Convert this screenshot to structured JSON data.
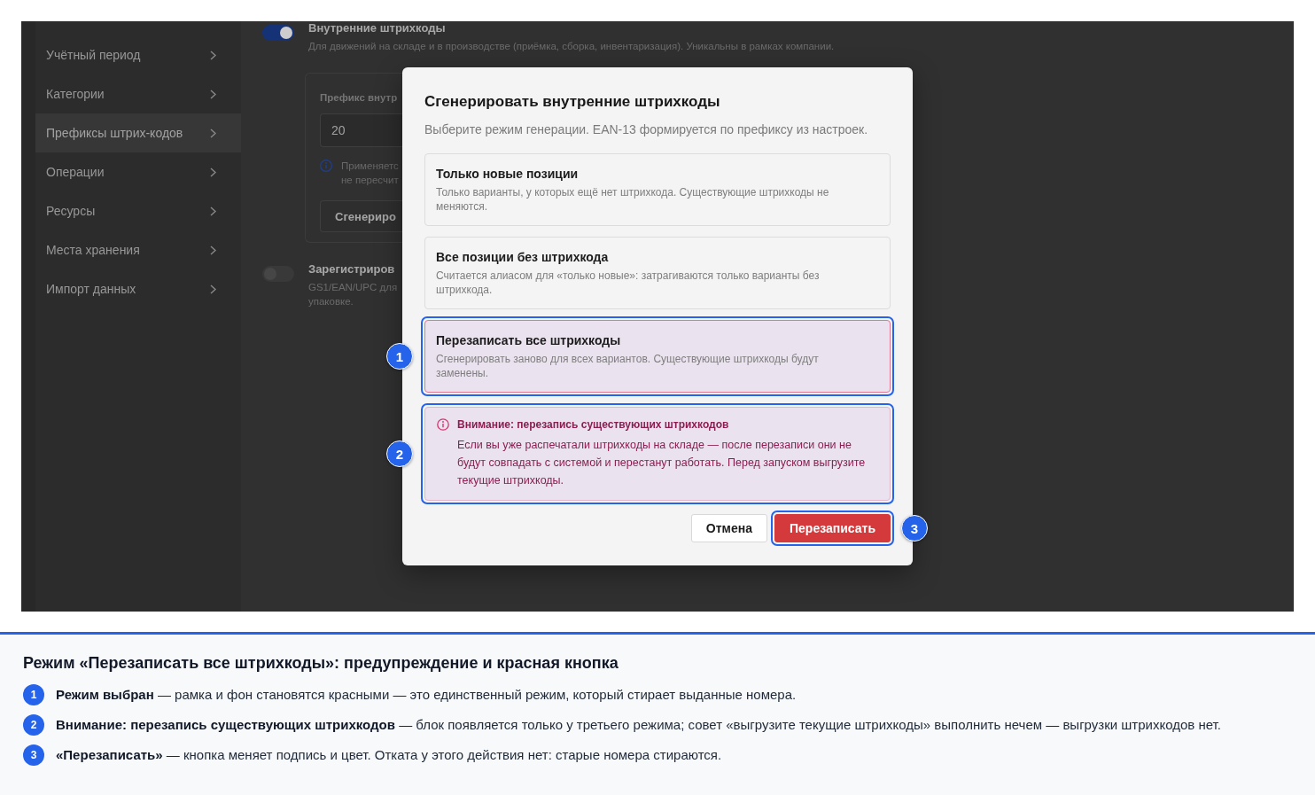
{
  "sidebar": {
    "items": [
      {
        "label": "Учётный период",
        "selected": false
      },
      {
        "label": "Категории",
        "selected": false
      },
      {
        "label": "Префиксы штрих-кодов",
        "selected": true
      },
      {
        "label": "Операции",
        "selected": false
      },
      {
        "label": "Ресурсы",
        "selected": false
      },
      {
        "label": "Места хранения",
        "selected": false
      },
      {
        "label": "Импорт данных",
        "selected": false
      }
    ]
  },
  "settings": {
    "sections": [
      {
        "on": true,
        "title": "Внутренние штрихкоды",
        "description_lines": [
          "Для движений на складе и в производстве (приёмка, сборка, инвентаризация). Уникальны в рамках компании."
        ],
        "card": {
          "field_label": "Префикс внутр",
          "field_value": "20",
          "hint_lines": [
            "Применяетс",
            "не пересчит"
          ],
          "button": "Сгенериро"
        }
      },
      {
        "on": false,
        "title": "Зарегистриров",
        "description_lines": [
          "GS1/EAN/UPC для",
          "упаковке."
        ]
      }
    ]
  },
  "dialog": {
    "title": "Сгенерировать внутренние штрихкоды",
    "subtitle": "Выберите режим генерации. EAN-13 формируется по префиксу из настроек.",
    "modes": [
      {
        "title": "Только новые позиции",
        "description": "Только варианты, у которых ещё нет штрихкода. Существующие штрихкоды не меняются.",
        "selected": false
      },
      {
        "title": "Все позиции без штрихкода",
        "description": "Считается алиасом для «только новые»: затрагиваются только варианты без штрихкода.",
        "selected": false
      },
      {
        "title": "Перезаписать все штрихкоды",
        "description": "Сгенерировать заново для всех вариантов. Существующие штрихкоды будут заменены.",
        "selected": true,
        "callout": "1"
      }
    ],
    "warning": {
      "title": "Внимание: перезапись существующих штрихкодов",
      "text": "Если вы уже распечатали штрихкоды на складе — после перезаписи они не будут совпадать с системой и перестанут работать. Перед запуском выгрузите текущие штрихкоды.",
      "callout": "2"
    },
    "buttons": [
      {
        "label": "Отмена",
        "kind": "secondary"
      },
      {
        "label": "Перезаписать",
        "kind": "danger",
        "callout": "3"
      }
    ]
  },
  "caption": {
    "title": "Режим «Перезаписать все штрихкоды»: предупреждение и красная кнопка",
    "items": [
      {
        "number": "1",
        "text": "**Режим выбран** — рамка и фон становятся красными — это единственный режим, который стирает выданные номера."
      },
      {
        "number": "2",
        "text": "**Внимание: перезапись существующих штрихкодов** — блок появляется только у третьего режима; совет «выгрузите текущие штрихкоды» выполнить нечем — выгрузки штрихкодов нет."
      },
      {
        "number": "3",
        "text": "**«Перезаписать»** — кнопка меняет подпись и цвет. Отката у этого действия нет: старые номера стираются."
      }
    ]
  }
}
